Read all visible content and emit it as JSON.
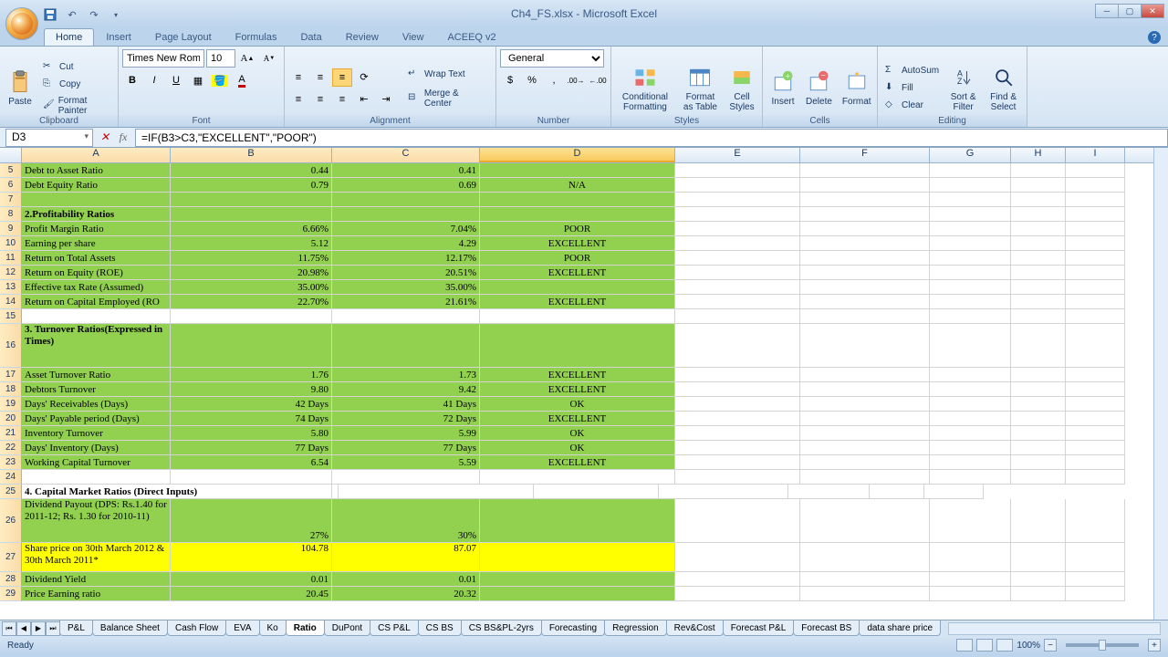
{
  "app": {
    "title": "Ch4_FS.xlsx - Microsoft Excel"
  },
  "tabs": {
    "home": "Home",
    "insert": "Insert",
    "pagelayout": "Page Layout",
    "formulas": "Formulas",
    "data": "Data",
    "review": "Review",
    "view": "View",
    "aceeq": "ACEEQ v2"
  },
  "ribbon": {
    "clipboard": {
      "label": "Clipboard",
      "paste": "Paste",
      "cut": "Cut",
      "copy": "Copy",
      "fmt": "Format Painter"
    },
    "font": {
      "label": "Font",
      "name": "Times New Rom",
      "size": "10"
    },
    "alignment": {
      "label": "Alignment",
      "wrap": "Wrap Text",
      "merge": "Merge & Center"
    },
    "number": {
      "label": "Number",
      "fmt": "General"
    },
    "styles": {
      "label": "Styles",
      "cond": "Conditional Formatting",
      "table": "Format as Table",
      "cell": "Cell Styles"
    },
    "cells": {
      "label": "Cells",
      "insert": "Insert",
      "delete": "Delete",
      "format": "Format"
    },
    "editing": {
      "label": "Editing",
      "autosum": "AutoSum",
      "fill": "Fill",
      "clear": "Clear",
      "sort": "Sort & Filter",
      "find": "Find & Select"
    }
  },
  "fbar": {
    "name": "D3",
    "formula": "=IF(B3>C3,\"EXCELLENT\",\"POOR\")"
  },
  "cols": [
    "A",
    "B",
    "C",
    "D",
    "E",
    "F",
    "G",
    "H",
    "I"
  ],
  "rows": [
    {
      "n": "5",
      "a": "Debt to Asset Ratio",
      "b": "0.44",
      "c": "0.41",
      "d": "",
      "g": true
    },
    {
      "n": "6",
      "a": "Debt Equity Ratio",
      "b": "0.79",
      "c": "0.69",
      "d": "N/A",
      "dC": true,
      "g": true
    },
    {
      "n": "7",
      "a": "",
      "b": "",
      "c": "",
      "d": "",
      "g": true
    },
    {
      "n": "8",
      "a": "2.Profitability Ratios",
      "bold": true,
      "b": "",
      "c": "",
      "d": "",
      "g": true
    },
    {
      "n": "9",
      "a": "Profit Margin Ratio",
      "b": "6.66%",
      "c": "7.04%",
      "d": "POOR",
      "dC": true,
      "g": true
    },
    {
      "n": "10",
      "a": "Earning per share",
      "b": "5.12",
      "c": "4.29",
      "d": "EXCELLENT",
      "dC": true,
      "g": true
    },
    {
      "n": "11",
      "a": "Return on Total Assets",
      "b": "11.75%",
      "c": "12.17%",
      "d": "POOR",
      "dC": true,
      "g": true
    },
    {
      "n": "12",
      "a": "Return on Equity (ROE)",
      "b": "20.98%",
      "c": "20.51%",
      "d": "EXCELLENT",
      "dC": true,
      "g": true
    },
    {
      "n": "13",
      "a": "Effective tax Rate (Assumed)",
      "b": "35.00%",
      "c": "35.00%",
      "d": "",
      "g": true
    },
    {
      "n": "14",
      "a": "Return on Capital Employed (RO",
      "b": "22.70%",
      "c": "21.61%",
      "d": "EXCELLENT",
      "dC": true,
      "g": true
    },
    {
      "n": "15",
      "a": "",
      "b": "",
      "c": "",
      "d": ""
    },
    {
      "n": "16",
      "a": "3.  Turnover  Ratios(Expressed in Times)",
      "bold": true,
      "b": "",
      "c": "",
      "d": "",
      "g": true,
      "tall": true,
      "wrap": true
    },
    {
      "n": "17",
      "a": "Asset Turnover Ratio",
      "b": "1.76",
      "c": "1.73",
      "d": "EXCELLENT",
      "dC": true,
      "g": true
    },
    {
      "n": "18",
      "a": "Debtors Turnover",
      "b": "9.80",
      "c": "9.42",
      "d": "EXCELLENT",
      "dC": true,
      "g": true
    },
    {
      "n": "19",
      "a": "Days' Receivables (Days)",
      "b": "42 Days",
      "c": "41 Days",
      "d": "OK",
      "dC": true,
      "g": true
    },
    {
      "n": "20",
      "a": "Days' Payable period (Days)",
      "b": "74 Days",
      "c": "72 Days",
      "d": "EXCELLENT",
      "dC": true,
      "g": true
    },
    {
      "n": "21",
      "a": "Inventory Turnover",
      "b": "5.80",
      "c": "5.99",
      "d": "OK",
      "dC": true,
      "g": true
    },
    {
      "n": "22",
      "a": "Days' Inventory (Days)",
      "b": "77 Days",
      "c": "77 Days",
      "d": "OK",
      "dC": true,
      "g": true
    },
    {
      "n": "23",
      "a": "Working Capital Turnover",
      "b": "6.54",
      "c": "5.59",
      "d": "EXCELLENT",
      "dC": true,
      "g": true
    },
    {
      "n": "24",
      "a": "",
      "b": "",
      "c": "",
      "d": ""
    },
    {
      "n": "25",
      "a": "4. Capital Market Ratios (Direct Inputs)",
      "bold": true,
      "b": "",
      "c": "",
      "d": "",
      "span": true
    },
    {
      "n": "26",
      "a": "Dividend Payout (DPS: Rs.1.40 for 2011-12; Rs. 1.30 for 2010-11)",
      "b": "27%",
      "c": "30%",
      "d": "",
      "g": true,
      "tall": true,
      "wrap": true
    },
    {
      "n": "27",
      "a": "Share price on 30th March 2012 & 30th March  2011*",
      "b": "104.78",
      "c": "87.07",
      "d": "",
      "y": true,
      "tall2": true,
      "wrap": true
    },
    {
      "n": "28",
      "a": "Dividend Yield",
      "b": "0.01",
      "c": "0.01",
      "d": "",
      "g": true
    },
    {
      "n": "29",
      "a": "Price Earning ratio",
      "b": "20.45",
      "c": "20.32",
      "d": "",
      "g": true
    }
  ],
  "sheets": [
    "P&L",
    "Balance Sheet",
    "Cash Flow",
    "EVA",
    "Ko",
    "Ratio",
    "DuPont",
    "CS P&L",
    "CS BS",
    "CS BS&PL-2yrs",
    "Forecasting",
    "Regression",
    "Rev&Cost",
    "Forecast P&L",
    "Forecast BS",
    "data share price"
  ],
  "activeSheet": "Ratio",
  "status": {
    "text": "Ready",
    "zoom": "100%"
  }
}
